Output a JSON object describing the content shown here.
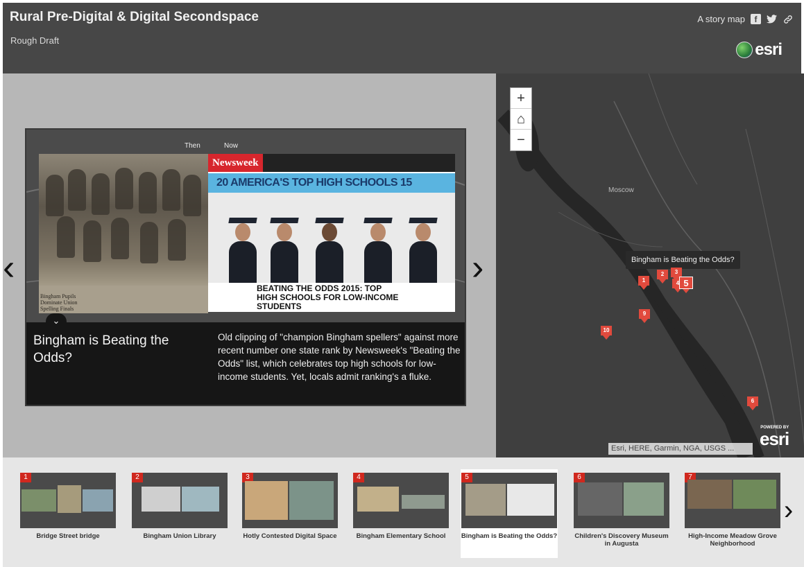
{
  "header": {
    "title": "Rural Pre-Digital & Digital Secondspace",
    "subtitle": "Rough Draft",
    "story_map_label": "A story map",
    "share": {
      "facebook": "f",
      "twitter": "t",
      "link": "⊘"
    },
    "brand": "esri"
  },
  "slide": {
    "then_label": "Then",
    "now_label": "Now",
    "clipping_text": [
      "Bingham Pupils",
      "Dominate Union",
      "Spelling Finals"
    ],
    "newsweek": {
      "logo": "Newsweek",
      "banner": "20  AMERICA'S TOP  HIGH SCHOOLS  15",
      "headline": [
        "BEATING THE ODDS 2015: TOP",
        "HIGH SCHOOLS FOR LOW-INCOME",
        "STUDENTS"
      ]
    },
    "prev_icon": "‹",
    "next_icon": "›",
    "collapse_icon": "⌄",
    "title": "Bingham is Beating the Odds?",
    "description": "Old clipping of \"champion Bingham spellers\" against more recent number one state rank by Newsweek's \"Beating the Odds\" list, which celebrates top high schools for low-income students. Yet, locals admit ranking's a fluke."
  },
  "map": {
    "zoom_in": "+",
    "home": "⌂",
    "zoom_out": "−",
    "places": {
      "moscow": "Moscow"
    },
    "tooltip": "Bingham is Beating the Odds?",
    "pins": {
      "p1": "1",
      "p2": "2",
      "p3": "3",
      "p4": "4",
      "p5": "5",
      "p6": "6",
      "p9": "9",
      "p10": "10"
    },
    "attribution": "Esri, HERE, Garmin, NGA, USGS ...",
    "powered_by": "POWERED BY",
    "powered_brand": "esri"
  },
  "carousel": {
    "items": [
      {
        "num": "1",
        "label": "Bridge Street bridge"
      },
      {
        "num": "2",
        "label": "Bingham Union Library"
      },
      {
        "num": "3",
        "label": "Hotly Contested Digital Space"
      },
      {
        "num": "4",
        "label": "Bingham Elementary School"
      },
      {
        "num": "5",
        "label": "Bingham is Beating the Odds?"
      },
      {
        "num": "6",
        "label": "Children's Discovery Museum in Augusta"
      },
      {
        "num": "7",
        "label": "High-Income Meadow Grove Neighborhood"
      }
    ],
    "next_icon": "›"
  }
}
